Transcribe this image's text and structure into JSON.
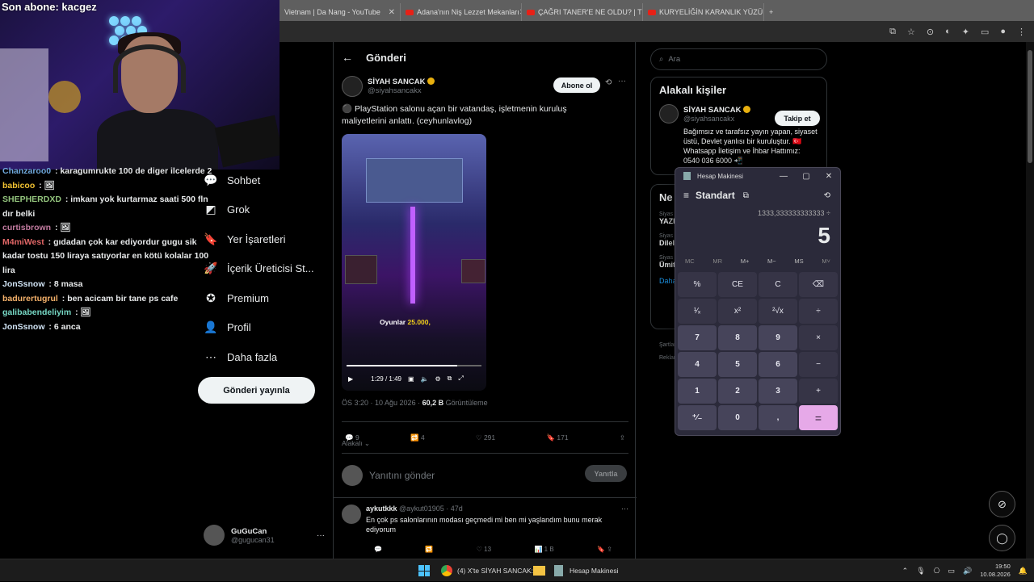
{
  "browser": {
    "tabs": [
      {
        "label": "Vietnam | Da Nang - YouTube"
      },
      {
        "label": "Adana'nın Niş Lezzet Mekanları"
      },
      {
        "label": "ÇAĞRI TANER'E NE OLDU? | TÜ"
      },
      {
        "label": "KURYELİĞİN KARANLIK YÜZÜ:"
      }
    ]
  },
  "stream": {
    "last_sub": "Son abone: kacgez",
    "chat": [
      {
        "user": "Chanzaroo0",
        "color": "#6fa8dc",
        "msg": "karagumrukte 100 de diger ilcelerde 2"
      },
      {
        "user": "babicoo",
        "color": "#f1c232",
        "msg": "🖼"
      },
      {
        "user": "SHEPHERDXD",
        "color": "#93c47d",
        "msg": "imkanı yok kurtarmaz saati 500 fln dır belki"
      },
      {
        "user": "curtisbrown",
        "color": "#c27ba0",
        "msg": "🖼"
      },
      {
        "user": "M4miWest",
        "color": "#e06666",
        "msg": "gıdadan çok kar ediyordur gugu sik kadar tostu 150 liraya satıyorlar en kötü kolalar 100 lira"
      },
      {
        "user": "JonSsnow",
        "color": "#cfe2f3",
        "msg": "8 masa"
      },
      {
        "user": "badurertugrul",
        "color": "#f6b26b",
        "msg": "ben acicam bir tane ps cafe"
      },
      {
        "user": "galibabendeliyim",
        "color": "#76d7c4",
        "msg": "🖼"
      },
      {
        "user": "JonSsnow",
        "color": "#cfe2f3",
        "msg": "6 anca"
      }
    ]
  },
  "nav": {
    "items": [
      {
        "label": "Sohbet",
        "icon": "chat-icon"
      },
      {
        "label": "Grok",
        "icon": "grok-icon"
      },
      {
        "label": "Yer İşaretleri",
        "icon": "bookmark-icon"
      },
      {
        "label": "İçerik Üreticisi St...",
        "icon": "rocket-icon"
      },
      {
        "label": "Premium",
        "icon": "premium-icon"
      },
      {
        "label": "Profil",
        "icon": "profile-icon"
      },
      {
        "label": "Daha fazla",
        "icon": "more-icon"
      }
    ],
    "post_button": "Gönderi yayınla",
    "me": {
      "name": "GuGuCan",
      "handle": "@gugucan31",
      "more": "···"
    }
  },
  "post": {
    "header": "Gönderi",
    "author_name": "SİYAH SANCAK",
    "author_handle": "@siyahsancakx",
    "follow_label": "Abone ol",
    "more": "···",
    "text": "⚫ PlayStation salonu açan bir vatandaş, işletmenin kuruluş maliyetlerini anlattı. (ceyhunlavlog)",
    "video": {
      "caption_prefix": "Oyunlar",
      "caption_value": "25.000,",
      "time": "1:29 / 1:49",
      "progress": 0.82
    },
    "meta_time": "ÖS 3:20 · 10 Ağu 2026 · ",
    "meta_views": "60,2 B",
    "meta_views_label": " Görüntüleme",
    "replies": "9",
    "reposts": "4",
    "likes": "291",
    "bookmarks": "171",
    "related_label": "Alakalı",
    "reply_placeholder": "Yanıtını gönder",
    "reply_button": "Yanıtla"
  },
  "comment": {
    "name": "aykutkkk",
    "handle": "@aykut01905 · 47d",
    "more": "···",
    "text": "En çok ps salonlarının modası geçmedi mi ben mi yaşlandım bunu merak ediyorum",
    "likes": "13",
    "views": "1 B"
  },
  "sidebar": {
    "search_placeholder": "Ara",
    "related_title": "Alakalı kişiler",
    "person": {
      "name": "SİYAH SANCAK",
      "handle": "@siyahsancakx",
      "follow": "Takip et",
      "bio": "Bağımsız ve tarafsız yayın yapan, siyaset üstü, Devlet yanlısı bir kuruluştur. 🇹🇷 Whatsapp İletişim ve İhbar Hattımız: 0540 036 6000 📲"
    },
    "trends_title": "Ne",
    "trends": [
      {
        "cat": "Siyas",
        "name": "YAZI"
      },
      {
        "cat": "Siyas",
        "name": "Dilel"
      },
      {
        "cat": "Siyas",
        "name": "Ümit"
      }
    ],
    "more_link": "Daha",
    "footer": [
      "Şartlar",
      "Reklam"
    ]
  },
  "calculator": {
    "title": "Hesap Makinesi",
    "mode": "Standart",
    "expression": "1333,333333333333 ÷",
    "display": "5",
    "memory": [
      "MC",
      "MR",
      "M+",
      "M−",
      "MS",
      "M˅"
    ],
    "keys": [
      "%",
      "CE",
      "C",
      "⌫",
      "¹⁄ₓ",
      "x²",
      "²√x",
      "÷",
      "7",
      "8",
      "9",
      "×",
      "4",
      "5",
      "6",
      "−",
      "1",
      "2",
      "3",
      "+",
      "⁺⁄₋",
      "0",
      ",",
      "="
    ]
  },
  "taskbar": {
    "chrome_label": "(4) X'te SİYAH SANCAK:",
    "calc_label": "Hesap Makinesi",
    "time": "19:50",
    "date": "10.08.2026"
  }
}
